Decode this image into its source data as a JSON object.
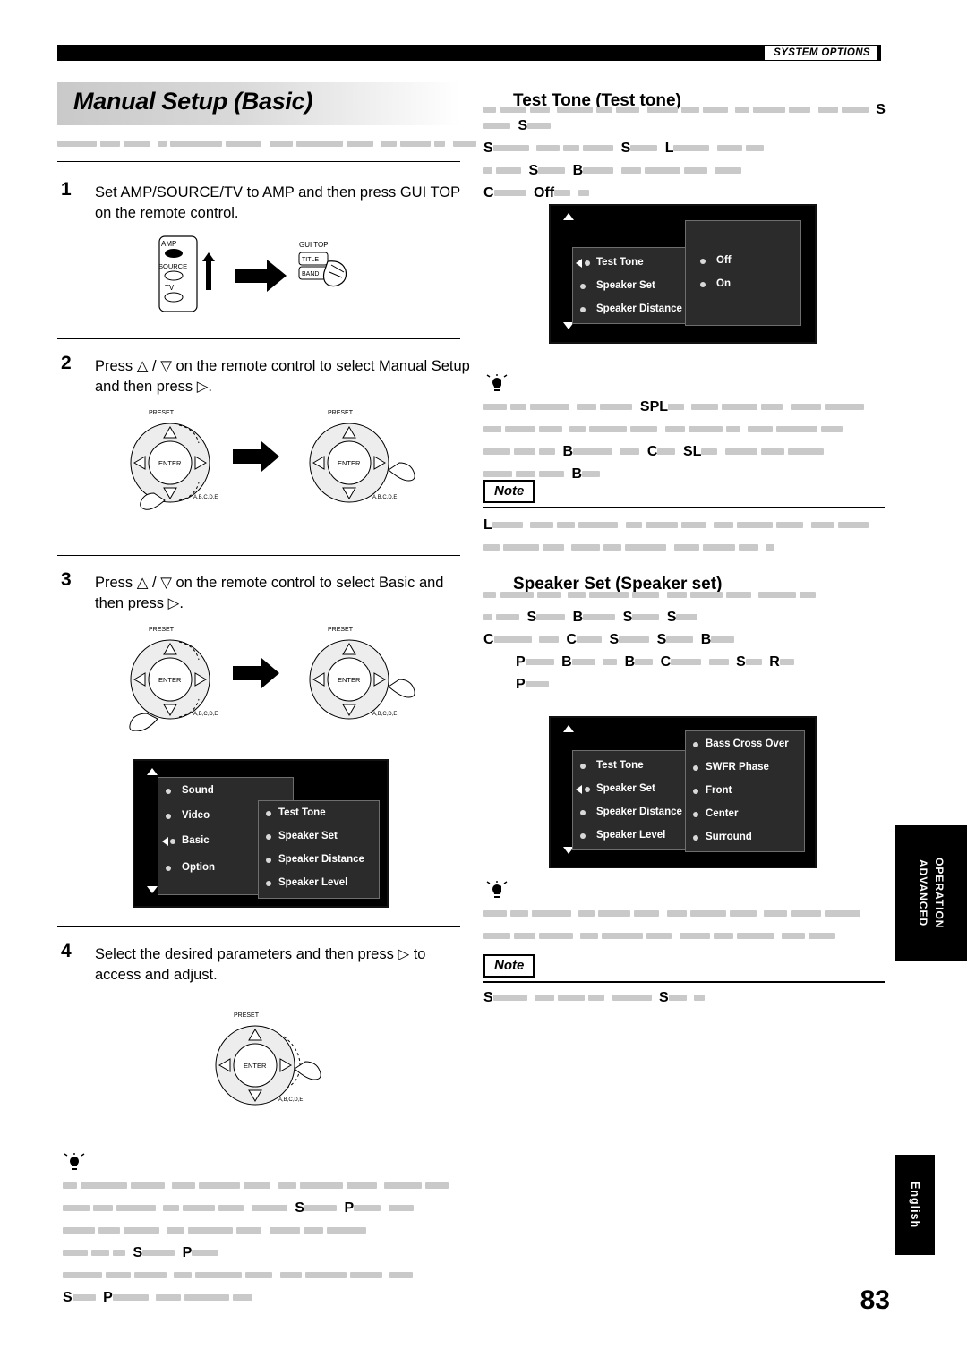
{
  "header": {
    "section_label": "SYSTEM OPTIONS"
  },
  "page_title": "Manual Setup (Basic)",
  "page_number": "83",
  "side_tabs": {
    "advanced": "ADVANCED",
    "operation": "OPERATION",
    "language": "English"
  },
  "steps": [
    {
      "num": "1",
      "text": "Set AMP/SOURCE/TV to  AMP and then press GUI TOP on the remote control."
    },
    {
      "num": "2",
      "text": "Press  △ / ▽ on the remote control to select Manual Setup and then press   ▷."
    },
    {
      "num": "3",
      "text": "Press  △ / ▽ on the remote control to select Basic and then press   ▷."
    },
    {
      "num": "4",
      "text": "Select the desired parameters and then press ▷ to access and adjust."
    }
  ],
  "remote_labels": {
    "amp": "AMP",
    "source": "SOURCE",
    "tv": "TV",
    "gui_top": "GUI TOP",
    "title": "TITLE",
    "band": "BAND",
    "preset": "PRESET",
    "enter": "ENTER",
    "abcde": "A,B,C,D,E"
  },
  "osd_basic": {
    "left_items": [
      "Sound",
      "Video",
      "Basic",
      "Option"
    ],
    "right_items": [
      "Test Tone",
      "Speaker Set",
      "Speaker Distance",
      "Speaker Level"
    ],
    "selected": "Basic"
  },
  "osd_test_tone": {
    "left_items": [
      "Test Tone",
      "Speaker Set",
      "Speaker Distance"
    ],
    "right_items": [
      "Off",
      "On"
    ],
    "selected": "Test Tone"
  },
  "osd_speaker_set": {
    "left_items": [
      "Test Tone",
      "Speaker Set",
      "Speaker Distance",
      "Speaker Level"
    ],
    "right_items": [
      "Bass Cross Over",
      "SWFR Phase",
      "Front",
      "Center",
      "Surround"
    ],
    "selected": "Speaker Set"
  },
  "right_column": {
    "test_tone_title": "Test Tone (Test tone)",
    "speaker_set_title": "Speaker Set (Speaker set)",
    "note_label": "Note"
  },
  "bold_fragments": {
    "f1": "S",
    "f2": "S",
    "f3": "S",
    "f4": "S",
    "f5": "L",
    "f6": "S",
    "f7": "B",
    "f8": "C",
    "f9": "Off",
    "f10": "SPL",
    "f11": "B",
    "f12": "C",
    "f13": "SL",
    "f14": "B",
    "f15": "L",
    "f16": "S",
    "f17": "B",
    "f18": "S",
    "f19": "S",
    "f20": "C",
    "f21": "C",
    "f22": "S",
    "f23": "S",
    "f24": "B",
    "f25": "P",
    "f26": "B",
    "f27": "B",
    "f28": "C",
    "f29": "S",
    "f30": "R",
    "f31": "P",
    "f32": "S",
    "f33": "S",
    "f34": "S",
    "f35": "P",
    "f36": "S",
    "f37": "P",
    "f38": "S",
    "f39": "P"
  }
}
